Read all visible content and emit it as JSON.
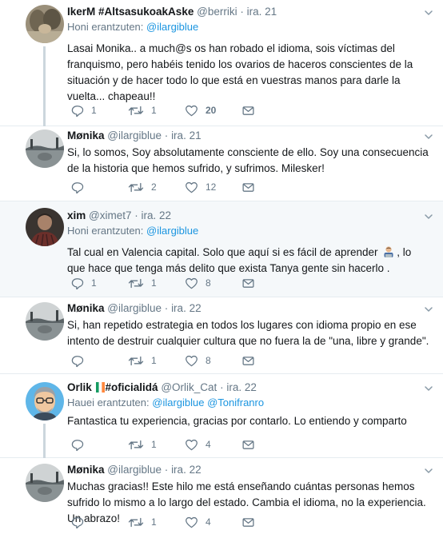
{
  "tweets": [
    {
      "name": "IkerM #AltsasukoakAske",
      "handle": "@berriki",
      "time": "ira. 21",
      "reply_label": "Honi erantzuten:",
      "reply_to": "@ilargiblue",
      "text": "Lasai Monika.. a much@s os han robado el idioma, sois víctimas del franquismo, pero habéis tenido los ovarios de haceros conscientes de la situación y de hacer todo lo que está en vuestras manos para darle la vuelta... chapeau!!",
      "replies": "1",
      "retweets": "1",
      "likes": "20"
    },
    {
      "name": "Mønika",
      "handle": "@ilargiblue",
      "time": "ira. 21",
      "text": "Si, lo somos, Soy absolutamente consciente de ello. Soy una consecuencia de la historia que hemos sufrido, y sufrimos. Milesker!",
      "replies": "",
      "retweets": "2",
      "likes": "12"
    },
    {
      "name": "xim",
      "handle": "@ximet7",
      "time": "ira. 22",
      "reply_label": "Honi erantzuten:",
      "reply_to": "@ilargiblue",
      "text_a": "Tal cual en Valencia capital. Solo que aquí si es fácil de aprender",
      "text_b": ", lo que hace que tenga más delito que exista Tanya gente sin hacerlo .",
      "replies": "1",
      "retweets": "1",
      "likes": "8"
    },
    {
      "name": "Mønika",
      "handle": "@ilargiblue",
      "time": "ira. 22",
      "text": "Si, han repetido estrategia en todos los lugares con idioma propio en ese intento de destruir cualquier cultura que no fuera la de \"una, libre y grande\".",
      "replies": "",
      "retweets": "1",
      "likes": "8"
    },
    {
      "name_a": "Orlik",
      "name_b": "#oficialidá",
      "handle": "@Orlik_Cat",
      "time": "ira. 22",
      "reply_label": "Hauei erantzuten:",
      "reply_to": "@ilargiblue @Tonifranro",
      "text": "Fantastica tu experiencia, gracias por contarlo. Lo entiendo y comparto",
      "replies": "",
      "retweets": "1",
      "likes": "4"
    },
    {
      "name": "Mønika",
      "handle": "@ilargiblue",
      "time": "ira. 22",
      "text": "Muchas gracias!! Este hilo me está enseñando cuántas personas hemos sufrido lo mismo a lo largo del estado. Cambia el idioma, no la experiencia. Un abrazo!",
      "replies": "",
      "retweets": "1",
      "likes": "4"
    }
  ],
  "icons": {
    "reply": "reply-icon",
    "retweet": "retweet-icon",
    "like": "heart-icon",
    "dm": "envelope-icon",
    "caret": "chevron-down-icon",
    "emoji": "man-technologist-emoji",
    "flag": "ireland-flag-emoji"
  },
  "colors": {
    "link": "#1b95e0",
    "secondary": "#657786",
    "thread_line": "#ccd6dd",
    "highlight_bg": "#f5f8fa"
  }
}
